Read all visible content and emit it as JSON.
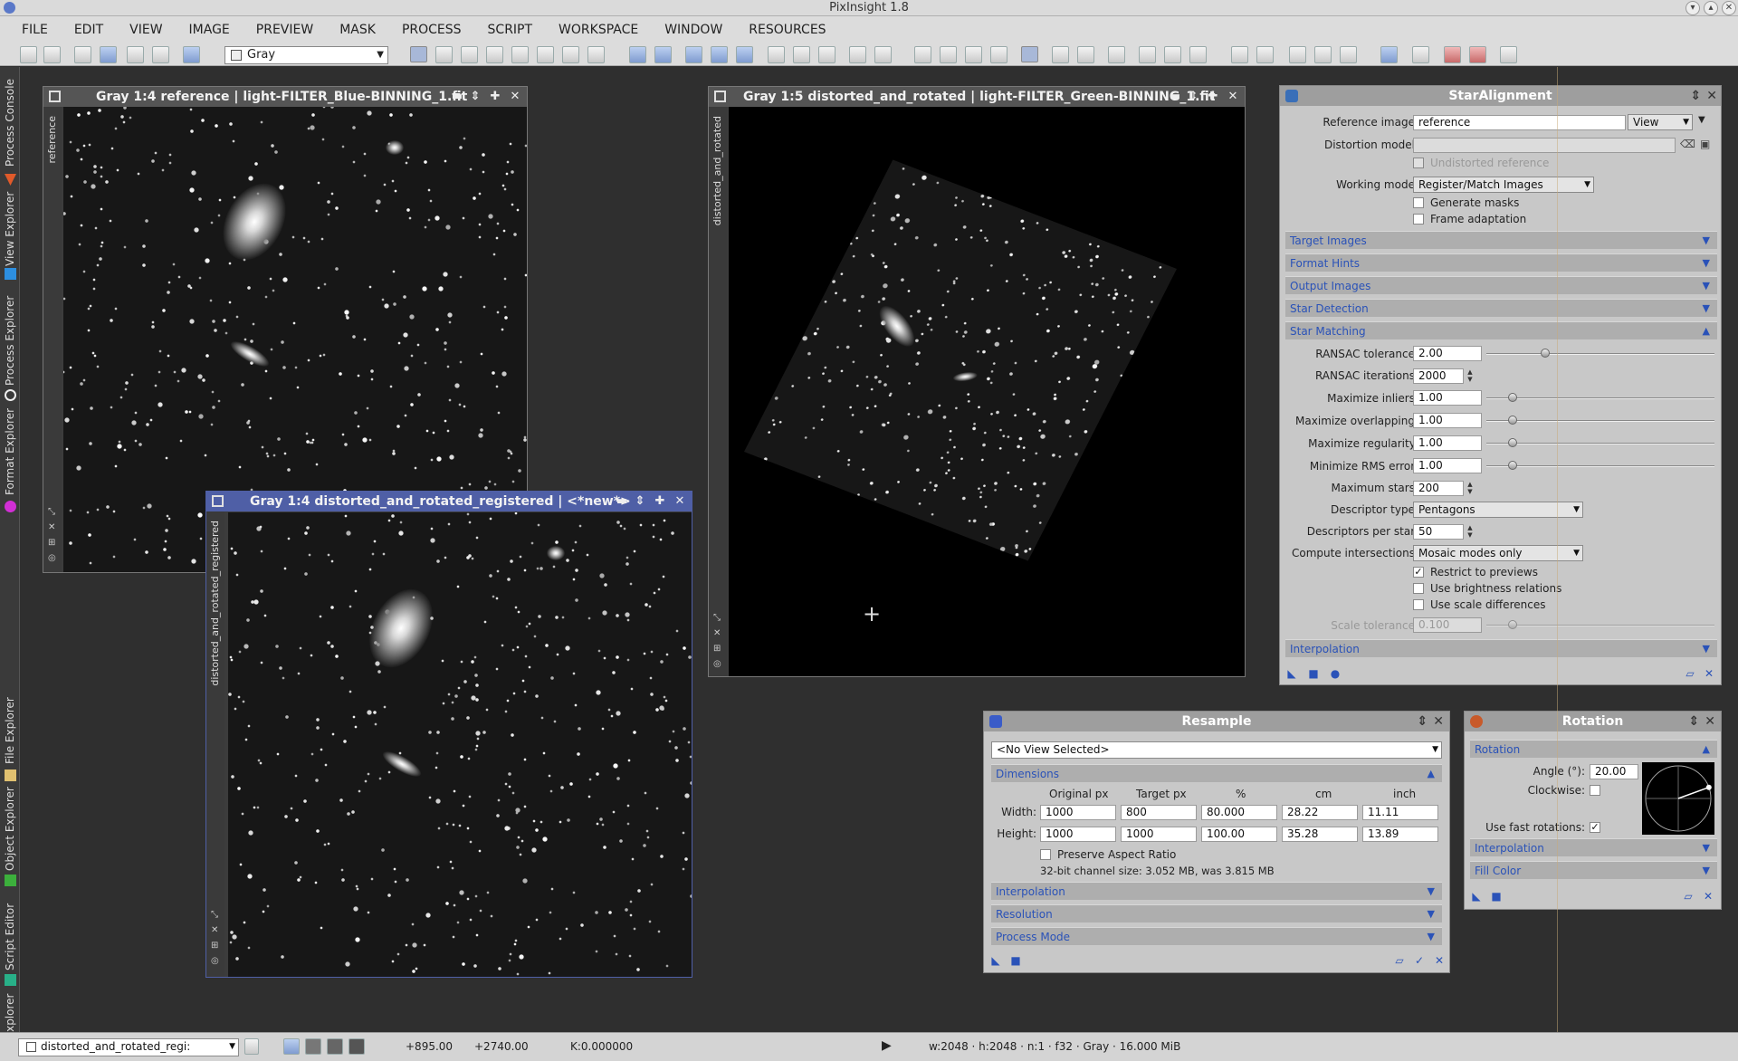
{
  "app": {
    "title": "PixInsight 1.8"
  },
  "menu": [
    "FILE",
    "EDIT",
    "VIEW",
    "IMAGE",
    "PREVIEW",
    "MASK",
    "PROCESS",
    "SCRIPT",
    "WORKSPACE",
    "WINDOW",
    "RESOURCES"
  ],
  "toolbar": {
    "view_selector": "Gray"
  },
  "left_dock": [
    "Process Console",
    "View Explorer",
    "Process Explorer",
    "Format Explorer",
    "File Explorer",
    "Object Explorer",
    "Script Editor",
    "History Explorer"
  ],
  "windows": {
    "reference": {
      "title": "Gray 1:4 reference | light-FILTER_Blue-BINNING_1.fit",
      "side_label": "reference"
    },
    "distorted": {
      "title": "Gray 1:5 distorted_and_rotated | light-FILTER_Green-BINNING_1.fit",
      "side_label": "distorted_and_rotated"
    },
    "registered": {
      "title": "Gray 1:4 distorted_and_rotated_registered | <*new*>",
      "side_label": "distorted_and_rotated_registered"
    }
  },
  "star_alignment": {
    "title": "StarAlignment",
    "reference_image_label": "Reference image:",
    "reference_image_value": "reference",
    "view_select": "View",
    "distortion_model_label": "Distortion model:",
    "distortion_model_value": "",
    "undistorted_reference": "Undistorted reference",
    "working_mode_label": "Working mode:",
    "working_mode_value": "Register/Match Images",
    "generate_masks": "Generate masks",
    "frame_adaptation": "Frame adaptation",
    "sections": [
      "Target Images",
      "Format Hints",
      "Output Images",
      "Star Detection",
      "Star Matching"
    ],
    "ransac_tolerance_label": "RANSAC tolerance:",
    "ransac_tolerance": "2.00",
    "ransac_iterations_label": "RANSAC iterations:",
    "ransac_iterations": "2000",
    "maximize_inliers_label": "Maximize inliers:",
    "maximize_inliers": "1.00",
    "maximize_overlapping_label": "Maximize overlapping:",
    "maximize_overlapping": "1.00",
    "maximize_regularity_label": "Maximize regularity:",
    "maximize_regularity": "1.00",
    "minimize_rms_label": "Minimize RMS error:",
    "minimize_rms": "1.00",
    "maximum_stars_label": "Maximum stars:",
    "maximum_stars": "200",
    "descriptor_type_label": "Descriptor type:",
    "descriptor_type": "Pentagons",
    "descriptors_per_star_label": "Descriptors per star:",
    "descriptors_per_star": "50",
    "compute_intersections_label": "Compute intersections:",
    "compute_intersections": "Mosaic modes only",
    "restrict_to_previews": "Restrict to previews",
    "use_brightness_relations": "Use brightness relations",
    "use_scale_differences": "Use scale differences",
    "scale_tolerance_label": "Scale tolerance:",
    "scale_tolerance": "0.100",
    "interpolation": "Interpolation"
  },
  "resample": {
    "title": "Resample",
    "view_selected": "<No View Selected>",
    "dimensions": "Dimensions",
    "col_headers": [
      "Original px",
      "Target px",
      "%",
      "cm",
      "inch"
    ],
    "width_label": "Width:",
    "width": [
      "1000",
      "800",
      "80.000",
      "28.22",
      "11.11"
    ],
    "height_label": "Height:",
    "height": [
      "1000",
      "1000",
      "100.00",
      "35.28",
      "13.89"
    ],
    "preserve_aspect": "Preserve Aspect Ratio",
    "channel_size": "32-bit channel size: 3.052 MB, was 3.815 MB",
    "sections": [
      "Interpolation",
      "Resolution",
      "Process Mode"
    ]
  },
  "rotation": {
    "title": "Rotation",
    "section": "Rotation",
    "angle_label": "Angle (°):",
    "angle": "20.00",
    "clockwise_label": "Clockwise:",
    "fast_rotations_label": "Use fast rotations:",
    "sections": [
      "Interpolation",
      "Fill Color"
    ]
  },
  "statusbar": {
    "view": "distorted_and_rotated_regi:",
    "x": "+895.00",
    "y": "+2740.00",
    "k": "K:0.000000",
    "info": "w:2048 · h:2048 · n:1 · f32 · Gray · 16.000 MiB"
  }
}
